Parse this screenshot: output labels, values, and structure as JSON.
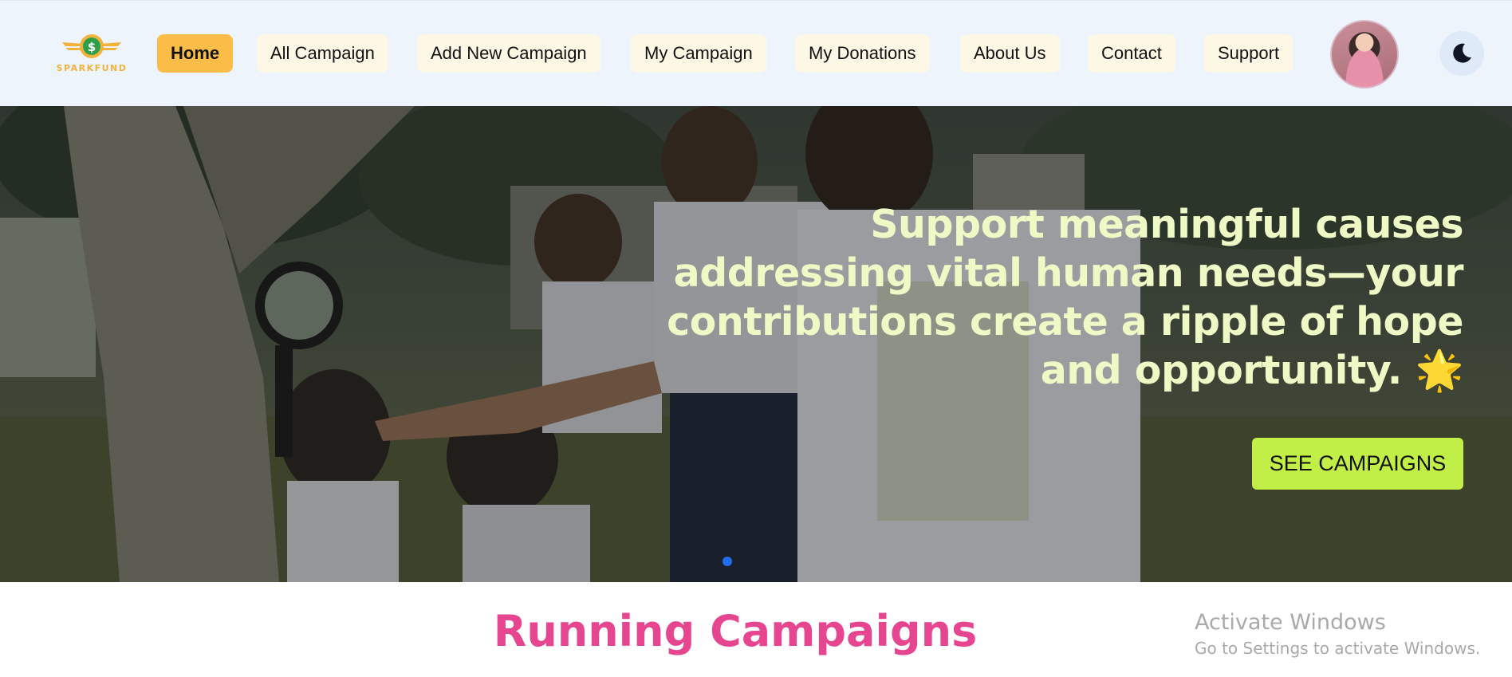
{
  "brand": {
    "logo_text": "SPARKFUND",
    "accent_color": "#f2b33d"
  },
  "nav": {
    "items": [
      {
        "label": "Home",
        "active": true
      },
      {
        "label": "All Campaign",
        "active": false
      },
      {
        "label": "Add New Campaign",
        "active": false
      },
      {
        "label": "My Campaign",
        "active": false
      },
      {
        "label": "My Donations",
        "active": false
      },
      {
        "label": "About Us",
        "active": false
      },
      {
        "label": "Contact",
        "active": false
      },
      {
        "label": "Support",
        "active": false
      }
    ],
    "active_color": "#fbbd48",
    "theme_toggle_icon": "moon-icon",
    "avatar_icon": "user-avatar"
  },
  "hero": {
    "headline_line1": "Support meaningful causes",
    "headline_line2": "addressing vital human needs—your",
    "headline_line3": "contributions create a ripple of hope",
    "headline_line4": "and opportunity.",
    "headline_emoji": "🌟",
    "cta_label": "SEE CAMPAIGNS",
    "cta_color": "#c2ef47",
    "headline_color": "#eef9c6",
    "slide_count": 1,
    "active_slide": 1
  },
  "section": {
    "title": "Running Campaigns",
    "title_color": "#e6458f"
  },
  "watermark": {
    "line1": "Activate Windows",
    "line2": "Go to Settings to activate Windows."
  }
}
